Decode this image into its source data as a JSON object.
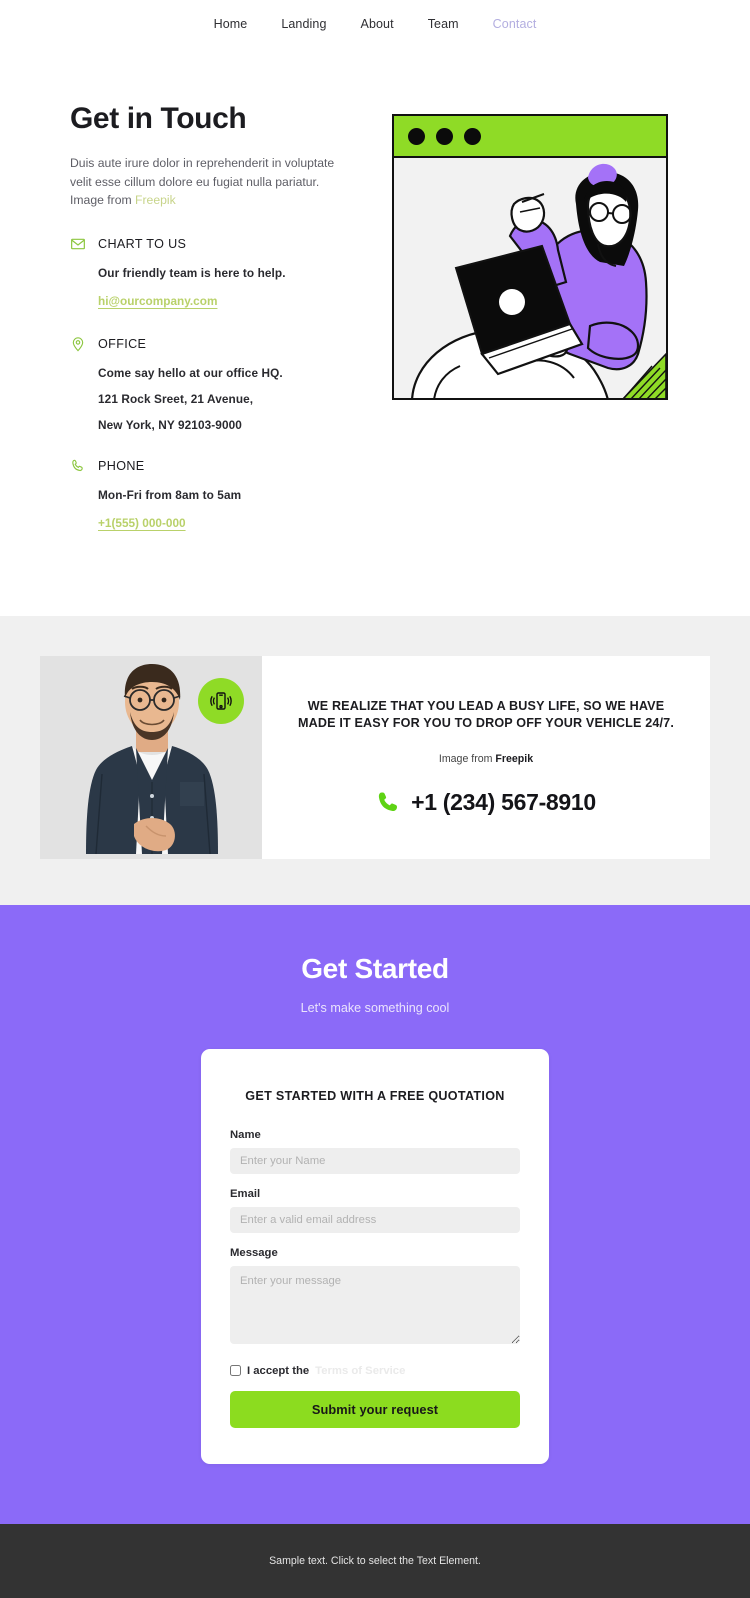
{
  "nav": {
    "items": [
      {
        "label": "Home",
        "active": false
      },
      {
        "label": "Landing",
        "active": false
      },
      {
        "label": "About",
        "active": false
      },
      {
        "label": "Team",
        "active": false
      },
      {
        "label": "Contact",
        "active": true
      }
    ]
  },
  "hero": {
    "title": "Get in Touch",
    "description": "Duis aute irure dolor in reprehenderit in voluptate velit esse cillum dolore eu fugiat nulla pariatur. Image from ",
    "credit_link": "Freepik",
    "contacts": [
      {
        "icon": "envelope-icon",
        "label": "CHART TO US",
        "line1": "Our friendly team is here to help.",
        "link": "hi@ourcompany.com"
      },
      {
        "icon": "map-pin-icon",
        "label": "OFFICE",
        "line1": "Come say hello at our office HQ.",
        "line2": "121 Rock Sreet, 21 Avenue,",
        "line3": "New York, NY 92103-9000"
      },
      {
        "icon": "phone-icon",
        "label": "PHONE",
        "line1": "Mon-Fri from 8am to 5am",
        "link": "+1(555) 000-000"
      }
    ],
    "illustration": {
      "name": "person-with-laptop-illustration",
      "window_dots": 3
    }
  },
  "band": {
    "photo_alt": "man-with-glasses-photo",
    "badge_icon": "vibrating-phone-icon",
    "headline": "WE REALIZE THAT YOU LEAD A BUSY LIFE, SO WE HAVE MADE IT EASY FOR YOU TO DROP OFF YOUR VEHICLE 24/7.",
    "credit_prefix": "Image from ",
    "credit_source": "Freepik",
    "phone_icon": "phone-handset-icon",
    "phone": "+1 (234) 567-8910"
  },
  "cta": {
    "title": "Get Started",
    "subtitle": "Let's make something cool",
    "form": {
      "title": "GET STARTED WITH A FREE QUOTATION",
      "name_label": "Name",
      "name_placeholder": "Enter your Name",
      "name_value": "",
      "email_label": "Email",
      "email_placeholder": "Enter a valid email address",
      "email_value": "",
      "message_label": "Message",
      "message_placeholder": "Enter your message",
      "message_value": "",
      "accept_text": "I accept the",
      "terms_link": "Terms of Service",
      "accept_checked": false,
      "submit_label": "Submit your request"
    }
  },
  "footer": {
    "text": "Sample text. Click to select the Text Element."
  },
  "colors": {
    "green": "#8cdc1f",
    "link_green": "#b9d16a",
    "purple": "#8b6af8",
    "band_gray": "#f0f0f0",
    "footer_dark": "#333333",
    "nav_active": "#b3aee0"
  }
}
